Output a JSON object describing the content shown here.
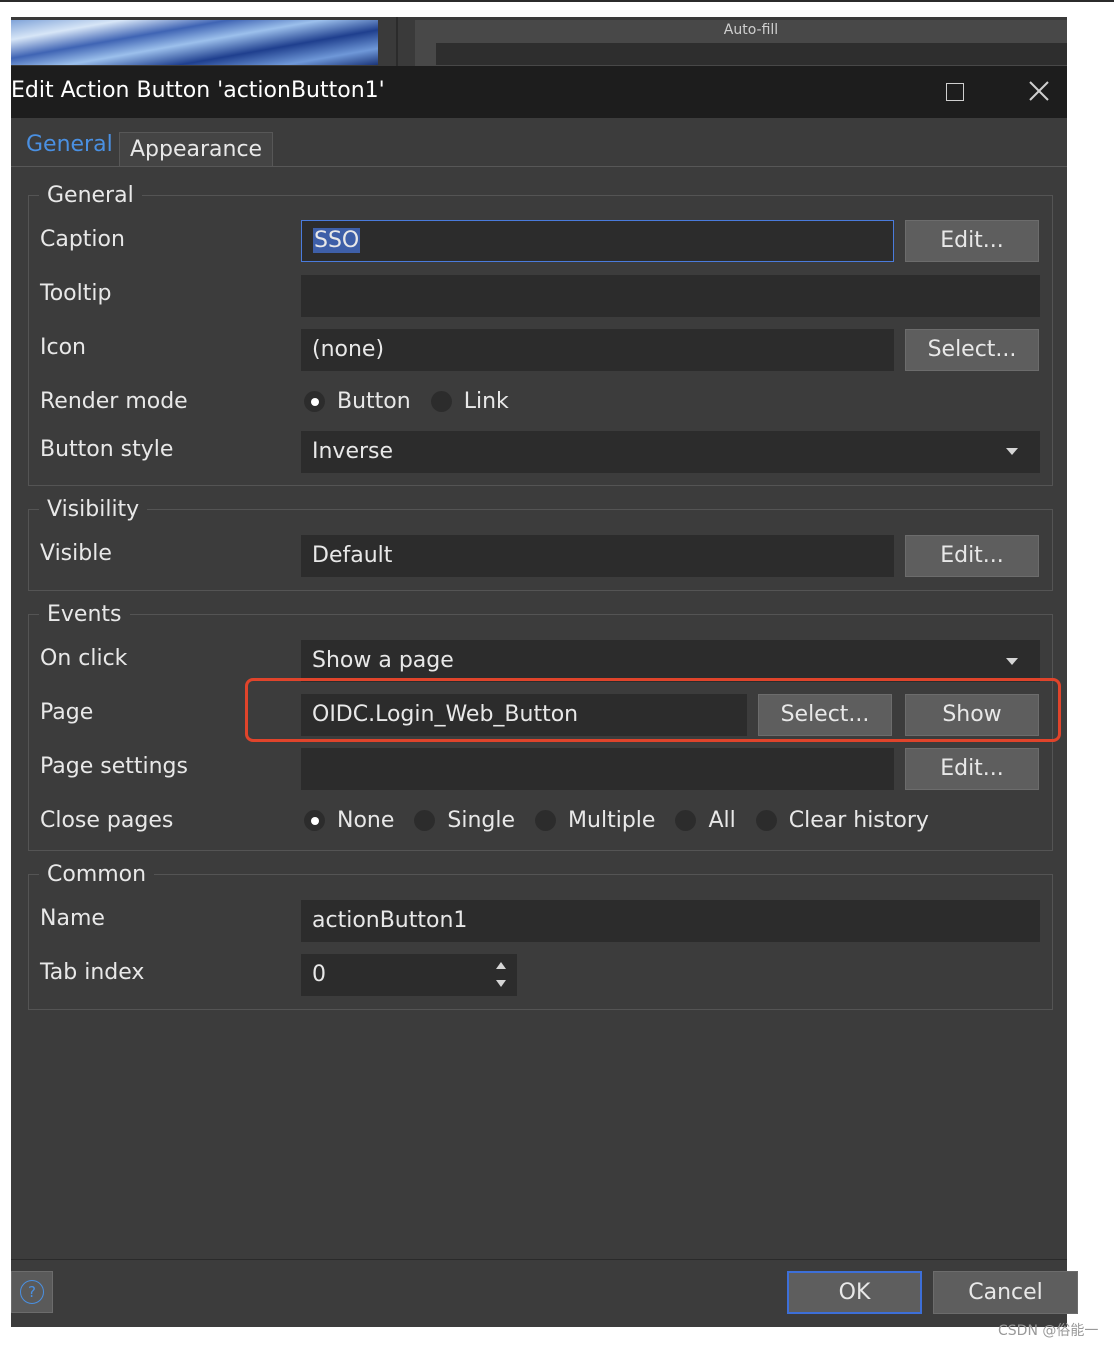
{
  "background_panel": {
    "autofill_label": "Auto-fill"
  },
  "dialog": {
    "title": "Edit Action Button 'actionButton1'",
    "tabs": [
      {
        "label": "General",
        "active": true
      },
      {
        "label": "Appearance",
        "active": false
      }
    ],
    "sections": {
      "general": {
        "legend": "General",
        "caption": {
          "label": "Caption",
          "value": "SSO",
          "button": "Edit..."
        },
        "tooltip": {
          "label": "Tooltip",
          "value": ""
        },
        "icon": {
          "label": "Icon",
          "value": "(none)",
          "button": "Select..."
        },
        "render_mode": {
          "label": "Render mode",
          "options": [
            "Button",
            "Link"
          ],
          "selected": "Button"
        },
        "button_style": {
          "label": "Button style",
          "value": "Inverse"
        }
      },
      "visibility": {
        "legend": "Visibility",
        "visible": {
          "label": "Visible",
          "value": "Default",
          "button": "Edit..."
        }
      },
      "events": {
        "legend": "Events",
        "on_click": {
          "label": "On click",
          "value": "Show a page"
        },
        "page": {
          "label": "Page",
          "value": "OIDC.Login_Web_Button",
          "select_button": "Select...",
          "show_button": "Show"
        },
        "page_settings": {
          "label": "Page settings",
          "value": "",
          "button": "Edit..."
        },
        "close_pages": {
          "label": "Close pages",
          "options": [
            "None",
            "Single",
            "Multiple",
            "All",
            "Clear history"
          ],
          "selected": "None"
        }
      },
      "common": {
        "legend": "Common",
        "name": {
          "label": "Name",
          "value": "actionButton1"
        },
        "tab_index": {
          "label": "Tab index",
          "value": "0"
        }
      }
    },
    "footer": {
      "help_icon": "?",
      "ok": "OK",
      "cancel": "Cancel"
    }
  },
  "watermark": "CSDN @俗能一",
  "colors": {
    "accent": "#4a90e2",
    "highlight": "#e0442b",
    "dialog_bg": "#3c3c3c",
    "titlebar_bg": "#1d1d1d"
  },
  "icons": [
    "maximize-icon",
    "close-icon",
    "help-icon",
    "chevron-down-icon",
    "spin-up-icon",
    "spin-down-icon"
  ]
}
